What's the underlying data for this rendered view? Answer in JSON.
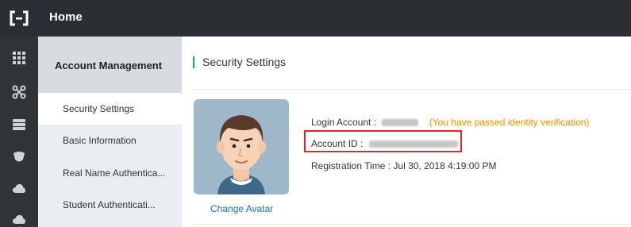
{
  "header": {
    "title": "Home"
  },
  "sidebar": {
    "title": "Account Management",
    "items": [
      {
        "label": "Security Settings",
        "active": true
      },
      {
        "label": "Basic Information",
        "active": false
      },
      {
        "label": "Real Name Authentica...",
        "active": false
      },
      {
        "label": "Student Authenticati...",
        "active": false
      }
    ]
  },
  "rail_icons": [
    "grid-icon",
    "network-icon",
    "storage-icon",
    "shield-icon",
    "cloud-icon",
    "upload-icon"
  ],
  "main": {
    "title": "Security Settings",
    "change_avatar": "Change Avatar",
    "login_account_label": "Login Account :",
    "verification_status": "(You have passed identity verification)",
    "account_id_label": "Account ID :",
    "registration_label": "Registration Time :",
    "registration_time": "Jul 30, 2018 4:19:00 PM"
  },
  "colors": {
    "topbar": "#2b2f33",
    "accent": "#00a2ca",
    "verified": "#f09000",
    "highlight": "#e0242c",
    "link": "#1f6fb4"
  }
}
